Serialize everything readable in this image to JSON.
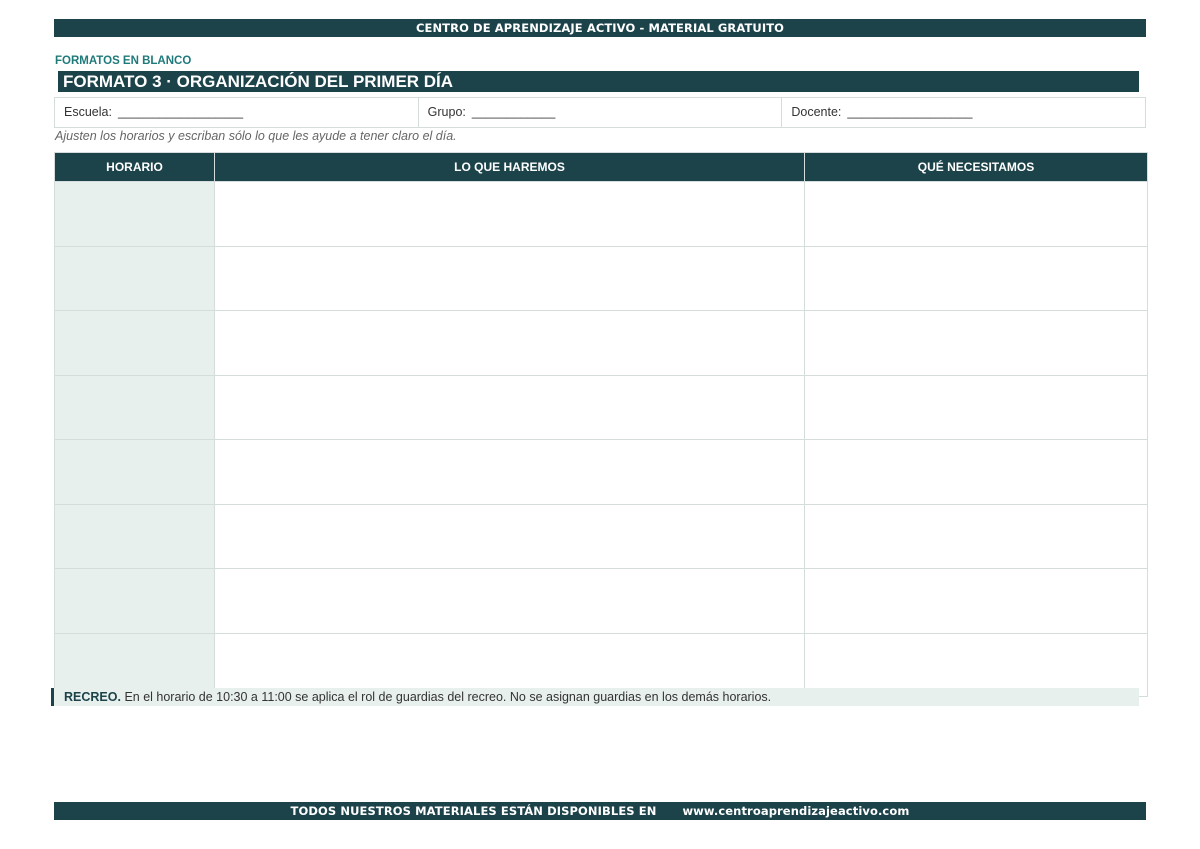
{
  "header": {
    "banner": "CENTRO DE APRENDIZAJE ACTIVO - MATERIAL GRATUITO",
    "section_label": "FORMATOS EN BLANCO",
    "title": "FORMATO 3 · ORGANIZACIÓN DEL PRIMER DÍA"
  },
  "info_fields": [
    {
      "label": "Escuela:",
      "blank": "__________________"
    },
    {
      "label": "Grupo:",
      "blank": "____________"
    },
    {
      "label": "Docente:",
      "blank": "__________________"
    }
  ],
  "instructions": "Ajusten los horarios y escriban sólo lo que les ayude a tener claro el día.",
  "table": {
    "columns": [
      "HORARIO",
      "LO QUE HAREMOS",
      "QUÉ NECESITAMOS"
    ],
    "row_count": 8
  },
  "note": {
    "strong": "RECREO.",
    "text": "En el horario de 10:30 a 11:00 se aplica el rol de guardias del recreo. No se asignan guardias en los demás horarios."
  },
  "footer": {
    "text": "TODOS NUESTROS MATERIALES ESTÁN DISPONIBLES EN",
    "url": "www.centroaprendizajeactivo.com"
  },
  "colors": {
    "brand_dark": "#1c434a",
    "accent_teal": "#1f7a7a",
    "cell_tint": "#e8f0ee",
    "border": "#d5dcdc"
  }
}
